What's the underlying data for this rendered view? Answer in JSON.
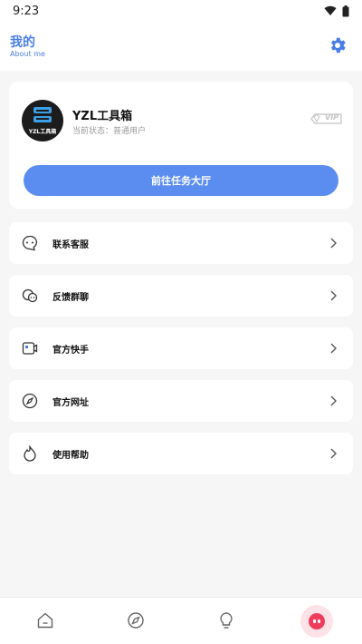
{
  "status_bar": {
    "time": "9:23",
    "wifi_icon": "wifi-icon",
    "battery_icon": "battery-icon"
  },
  "header": {
    "title": "我的",
    "subtitle": "About me",
    "settings_icon": "gear-icon"
  },
  "profile": {
    "app_name": "YZL工具箱",
    "avatar_text": "YZL工具箱",
    "status": "当前状态：普通用户",
    "vip_badge": "VIP",
    "task_button": "前往任务大厅"
  },
  "menu": [
    {
      "label": "联系客服",
      "icon": "chat-bubble-icon"
    },
    {
      "label": "反馈群聊",
      "icon": "group-chat-icon"
    },
    {
      "label": "官方快手",
      "icon": "video-card-icon"
    },
    {
      "label": "官方网址",
      "icon": "compass-icon"
    },
    {
      "label": "使用帮助",
      "icon": "flame-icon"
    }
  ],
  "bottom_nav": [
    {
      "icon": "home-icon"
    },
    {
      "icon": "compass-icon"
    },
    {
      "icon": "lightbulb-icon"
    },
    {
      "icon": "profile-face-icon",
      "active": true
    }
  ],
  "colors": {
    "accent": "#4a7ee6",
    "button": "#5b8df0",
    "active_nav": "#ef3b5c"
  }
}
